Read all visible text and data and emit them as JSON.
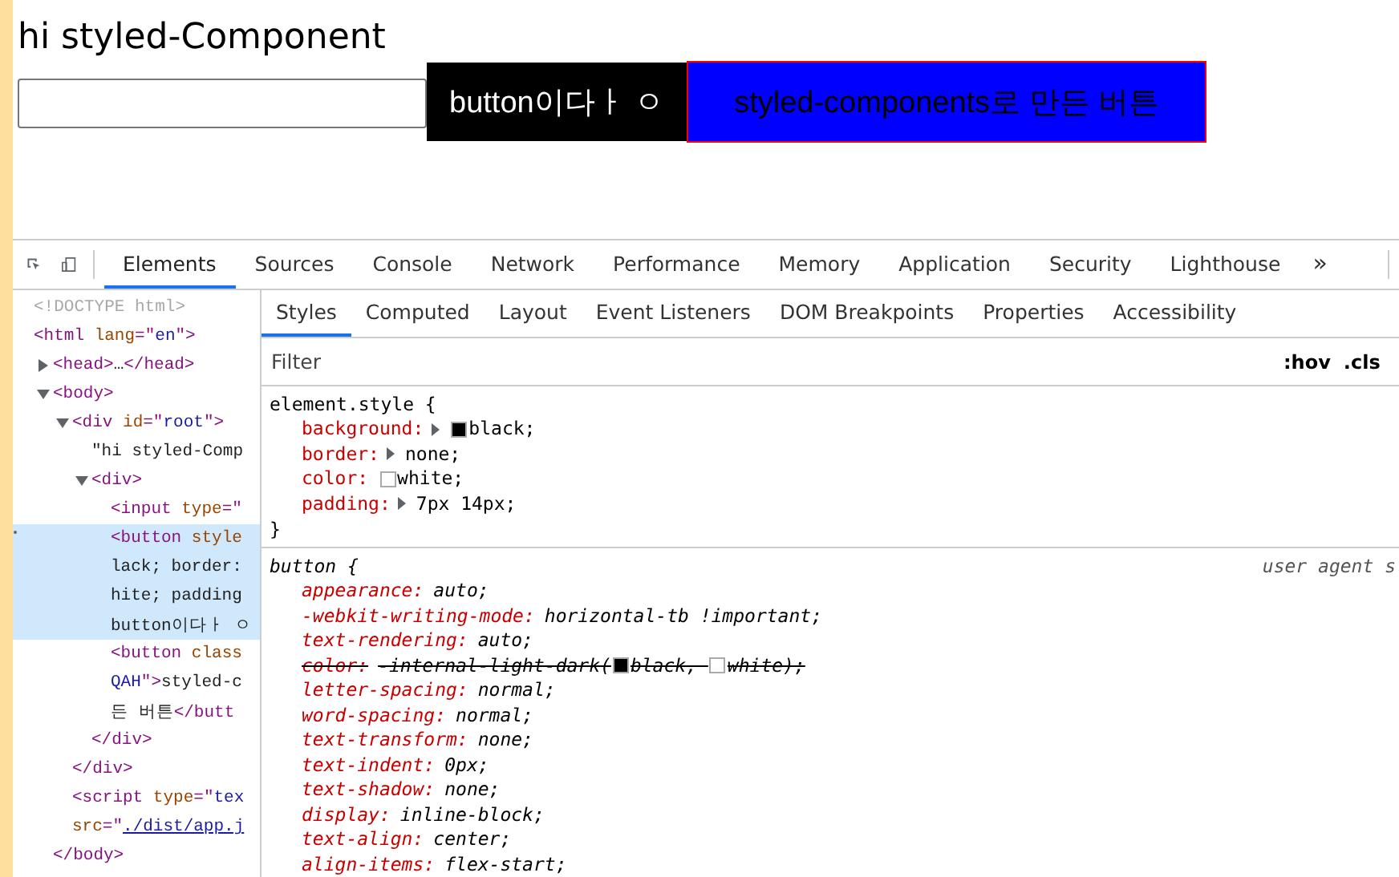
{
  "page": {
    "heading": "hi styled-Component",
    "buttons": [
      {
        "kind": "inline",
        "label": "button이다ㅏ ㅇ"
      },
      {
        "kind": "styled",
        "label": "styled-components로 만든 버튼"
      }
    ]
  },
  "devtools": {
    "tabs": [
      {
        "label": "Elements",
        "selected": true
      },
      {
        "label": "Sources",
        "selected": false
      },
      {
        "label": "Console",
        "selected": false
      },
      {
        "label": "Network",
        "selected": false
      },
      {
        "label": "Performance",
        "selected": false
      },
      {
        "label": "Memory",
        "selected": false
      },
      {
        "label": "Application",
        "selected": false
      },
      {
        "label": "Security",
        "selected": false
      },
      {
        "label": "Lighthouse",
        "selected": false
      }
    ],
    "more_tabs": "»",
    "dom_tree": [
      {
        "selected": false,
        "lines": [
          [
            {
              "kind": "doctype",
              "text": "<!DOCTYPE html>"
            }
          ]
        ]
      },
      {
        "selected": false,
        "lines": [
          [
            {
              "kind": "tag",
              "text": "<html "
            },
            {
              "kind": "attr",
              "text": "lang"
            },
            {
              "kind": "tag",
              "text": "=\""
            },
            {
              "kind": "value",
              "text": "en"
            },
            {
              "kind": "tag",
              "text": "\">"
            }
          ]
        ],
        "children": [
          {
            "selected": false,
            "expanded": false,
            "lines": [
              [
                {
                  "kind": "tag",
                  "text": "<head>"
                },
                {
                  "kind": "text",
                  "text": "…"
                },
                {
                  "kind": "tag",
                  "text": "</head>"
                }
              ]
            ]
          },
          {
            "selected": false,
            "expanded": true,
            "lines": [
              [
                {
                  "kind": "tag",
                  "text": "<body>"
                }
              ]
            ],
            "close": [
              {
                "kind": "tag",
                "text": "</body>"
              }
            ],
            "children": [
              {
                "selected": false,
                "expanded": true,
                "lines": [
                  [
                    {
                      "kind": "tag",
                      "text": "<div "
                    },
                    {
                      "kind": "attr",
                      "text": "id"
                    },
                    {
                      "kind": "tag",
                      "text": "=\""
                    },
                    {
                      "kind": "value",
                      "text": "root"
                    },
                    {
                      "kind": "tag",
                      "text": "\">"
                    }
                  ]
                ],
                "close": [
                  {
                    "kind": "tag",
                    "text": "</div>"
                  }
                ],
                "children": [
                  {
                    "selected": false,
                    "lines": [
                      [
                        {
                          "kind": "text",
                          "text": "\"hi styled-Comp"
                        }
                      ]
                    ]
                  },
                  {
                    "selected": false,
                    "expanded": true,
                    "lines": [
                      [
                        {
                          "kind": "tag",
                          "text": "<div>"
                        }
                      ]
                    ],
                    "close": [
                      {
                        "kind": "tag",
                        "text": "</div>"
                      }
                    ],
                    "children": [
                      {
                        "selected": false,
                        "lines": [
                          [
                            {
                              "kind": "tag",
                              "text": "<input "
                            },
                            {
                              "kind": "attr",
                              "text": "type"
                            },
                            {
                              "kind": "tag",
                              "text": "=\""
                            }
                          ]
                        ]
                      },
                      {
                        "selected": true,
                        "lines": [
                          [
                            {
                              "kind": "tag",
                              "text": "<button "
                            },
                            {
                              "kind": "attr",
                              "text": "style"
                            }
                          ],
                          [
                            {
                              "kind": "value",
                              "text": "lack; border:"
                            }
                          ],
                          [
                            {
                              "kind": "value",
                              "text": "hite; padding"
                            }
                          ],
                          [
                            {
                              "kind": "text",
                              "text": "button이다ㅏ ㅇ"
                            }
                          ]
                        ]
                      },
                      {
                        "selected": false,
                        "lines": [
                          [
                            {
                              "kind": "tag",
                              "text": "<button "
                            },
                            {
                              "kind": "attr",
                              "text": "class"
                            }
                          ],
                          [
                            {
                              "kind": "value",
                              "text": "QAH"
                            },
                            {
                              "kind": "tag",
                              "text": "\">"
                            },
                            {
                              "kind": "text",
                              "text": "styled-c"
                            }
                          ],
                          [
                            {
                              "kind": "text",
                              "text": "든 버튼"
                            },
                            {
                              "kind": "tag",
                              "text": "</butt"
                            }
                          ]
                        ]
                      }
                    ]
                  }
                ]
              },
              {
                "selected": false,
                "lines": [
                  [
                    {
                      "kind": "tag",
                      "text": "<script "
                    },
                    {
                      "kind": "attr",
                      "text": "type"
                    },
                    {
                      "kind": "tag",
                      "text": "=\""
                    },
                    {
                      "kind": "value",
                      "text": "tex"
                    }
                  ],
                  [
                    {
                      "kind": "attr",
                      "text": "src"
                    },
                    {
                      "kind": "tag",
                      "text": "=\""
                    },
                    {
                      "kind": "link",
                      "text": "./dist/app.j"
                    }
                  ]
                ]
              }
            ]
          }
        ]
      }
    ],
    "subtabs": [
      {
        "label": "Styles",
        "selected": true
      },
      {
        "label": "Computed",
        "selected": false
      },
      {
        "label": "Layout",
        "selected": false
      },
      {
        "label": "Event Listeners",
        "selected": false
      },
      {
        "label": "DOM Breakpoints",
        "selected": false
      },
      {
        "label": "Properties",
        "selected": false
      },
      {
        "label": "Accessibility",
        "selected": false
      }
    ],
    "filter": {
      "placeholder": "Filter"
    },
    "filter_buttons": [
      ":hov",
      ".cls"
    ],
    "rules": [
      {
        "selector": "element.style {",
        "kind": "inline",
        "close": "}",
        "declarations": [
          {
            "name": "background:",
            "expandable": true,
            "struck": false,
            "parts": [
              {
                "color": "#000000",
                "text": "black;"
              }
            ]
          },
          {
            "name": "border:",
            "expandable": true,
            "struck": false,
            "parts": [
              {
                "text": "none;"
              }
            ]
          },
          {
            "name": "color:",
            "expandable": false,
            "struck": false,
            "parts": [
              {
                "color": "#ffffff",
                "text": "white;"
              }
            ]
          },
          {
            "name": "padding:",
            "expandable": true,
            "struck": false,
            "parts": [
              {
                "text": "7px 14px;"
              }
            ]
          }
        ]
      },
      {
        "selector": "button {",
        "kind": "user-agent",
        "source": "user agent s",
        "declarations": [
          {
            "name": "appearance:",
            "expandable": false,
            "struck": false,
            "parts": [
              {
                "text": "auto;"
              }
            ]
          },
          {
            "name": "-webkit-writing-mode:",
            "expandable": false,
            "struck": false,
            "parts": [
              {
                "text": "horizontal-tb !important;"
              }
            ]
          },
          {
            "name": "text-rendering:",
            "expandable": false,
            "struck": false,
            "parts": [
              {
                "text": "auto;"
              }
            ]
          },
          {
            "name": "color:",
            "expandable": false,
            "struck": true,
            "parts": [
              {
                "text": "-internal-light-dark("
              },
              {
                "color": "#000000",
                "text": "black, "
              },
              {
                "color": "#ffffff",
                "text": "white);"
              }
            ]
          },
          {
            "name": "letter-spacing:",
            "expandable": false,
            "struck": false,
            "parts": [
              {
                "text": "normal;"
              }
            ]
          },
          {
            "name": "word-spacing:",
            "expandable": false,
            "struck": false,
            "parts": [
              {
                "text": "normal;"
              }
            ]
          },
          {
            "name": "text-transform:",
            "expandable": false,
            "struck": false,
            "parts": [
              {
                "text": "none;"
              }
            ]
          },
          {
            "name": "text-indent:",
            "expandable": false,
            "struck": false,
            "parts": [
              {
                "text": "0px;"
              }
            ]
          },
          {
            "name": "text-shadow:",
            "expandable": false,
            "struck": false,
            "parts": [
              {
                "text": "none;"
              }
            ]
          },
          {
            "name": "display:",
            "expandable": false,
            "struck": false,
            "parts": [
              {
                "text": "inline-block;"
              }
            ]
          },
          {
            "name": "text-align:",
            "expandable": false,
            "struck": false,
            "parts": [
              {
                "text": "center;"
              }
            ]
          },
          {
            "name": "align-items:",
            "expandable": false,
            "struck": false,
            "parts": [
              {
                "text": "flex-start;"
              }
            ]
          }
        ]
      }
    ]
  }
}
